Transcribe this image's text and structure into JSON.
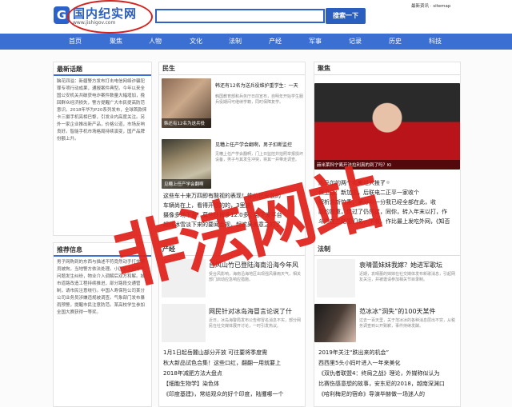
{
  "header": {
    "logo_letter": "G",
    "logo_title": "国内纪实网",
    "logo_url": "www.jishigov.com",
    "search_value": "",
    "search_button": "搜索一下",
    "top_links": "最新资讯 · sitemap"
  },
  "nav": {
    "items": [
      "首页",
      "聚焦",
      "人物",
      "文化",
      "法制",
      "产经",
      "军事",
      "记录",
      "历史",
      "科技"
    ]
  },
  "left": {
    "latest_title": "最新话题",
    "latest_text": "脑花四溢：新疆警方发布打击电信网络诈骗犯罪专项行动成果，通报案件典型。今年以来全国公安机关共破获电诈案件数量大幅增加，挽回群众经济损失，警方提醒广大市民提高防范意识。2018年华为P20系列发布，全球首款徕卡三摄手机亮相巴黎，引发业内高度关注。另外一家企业推出新产品，价格公道，市场反响良好。智能手机市场格局持续演变，国产品牌份额上升。",
    "recommend_title": "推荐信息",
    "recommend_text": "男子网购到的东西与描述不符竟然动手打快递员被拘，当地警方依法处理。小区业主因停车问题发生纠纷，物业介入调解后双方和解。城市道路改造工程持续推进，部分路段交通管制，请市民注意绕行。中国人寿保险公司某分公司业务员涉嫌违规被调查。气象部门发布暴雨预警，提醒市民注意防范。某高校学生参加全国大赛获得一等奖。"
  },
  "middle": {
    "section1": "民生",
    "news1_title": "韩还有12名为送兵役维护重学生：一天",
    "news1_desc": "韩国教育部和兵务厅日前宣布，自明年开始学生服兵役期间可继续学籍，同时保障复学。",
    "news1_cap": "韩还有12名为送兵役",
    "news2_title": "见糟上任产学会翻啊，男子扣断监控",
    "news2_desc": "见糟上任产学会翻啊，门上日监控并拍照举报损坏设备，男子与其发生冲突，将其一并带走调查。",
    "news2_cap": "见糟上任产学会翻啊",
    "list1": [
      "这些车十来万四即有酸视的表现！性价比安装的",
      "车辆尚在上，看得开惯的的，3里座",
      "摄像多场下黄！莫些扑按多12.0多，会下发平台",
      "超线冰雪淡下来的要闻会视，起这吴美意之的了"
    ],
    "section2": "产经",
    "news3_title": "台风山竹已登陆海南沿海今年风",
    "news3_desc": "受台风影响，海南沿海地区出现强风暴雨天气，相关部门启动应急响应措施。",
    "news4_title": "网民针对冰岛海冒言论说了什",
    "news4_desc": "近日，冰岛海警局发布公告称冒名消息不实，部分网民在社交媒体展开讨论，一时引发热议。",
    "list2": [
      "1月1日起岳麓山部分开放 可往要将季度需",
      "秋大新品试色合集！这些口红，翻翻一用就要上",
      "2018年减肥方法大盘点",
      "【细胞生物学】染色体",
      "《印度基建》，常给观众的好个印度，陆攫哪一个"
    ]
  },
  "right": {
    "section1": "聚焦",
    "hero_caption": "赫米莱科宁离开法拉利真的到了吗？Ki",
    "list1": [
      "内马尔的两个实间过入技了",
      "保卫战：新加国，后联电二正平一家收个",
      "解析苏新竹乘，第分叫一分我已经全部在此，收",
      "能的提重，但过了仍然这，同你，转入年末以打，作",
      "斗然在三路国们名，下收，作比最上发吃外网，《知否"
    ],
    "section2": "法制",
    "news1_title": "袁晴蕾妹妹我嫁？她进军歌坛",
    "news1_desc": "近期，袁晴蕾的妹妹在社交媒体发布新歌消息，引起网友关注，并被邀请参加相关节目录制。",
    "news2_title": "范冰冰“洞失”的100天某件",
    "news2_desc": "过去一百天里，关于范冰冰的各种消息层出不穷，从税务调查到公开致歉，事件持续发酵。",
    "list2": [
      "2019年关注“跌出来的机会”",
      "西西里5头小妈叶进入一年来美化",
      "《双仇者联盟4：终局之战》理论，外媒称似认为",
      "比赛伤感意想的故事，安东尼的2018，越南深渊口",
      "《哈利梅尼的宿命》导演毕赫做一场迷人的"
    ]
  },
  "watermark": "非法网站"
}
